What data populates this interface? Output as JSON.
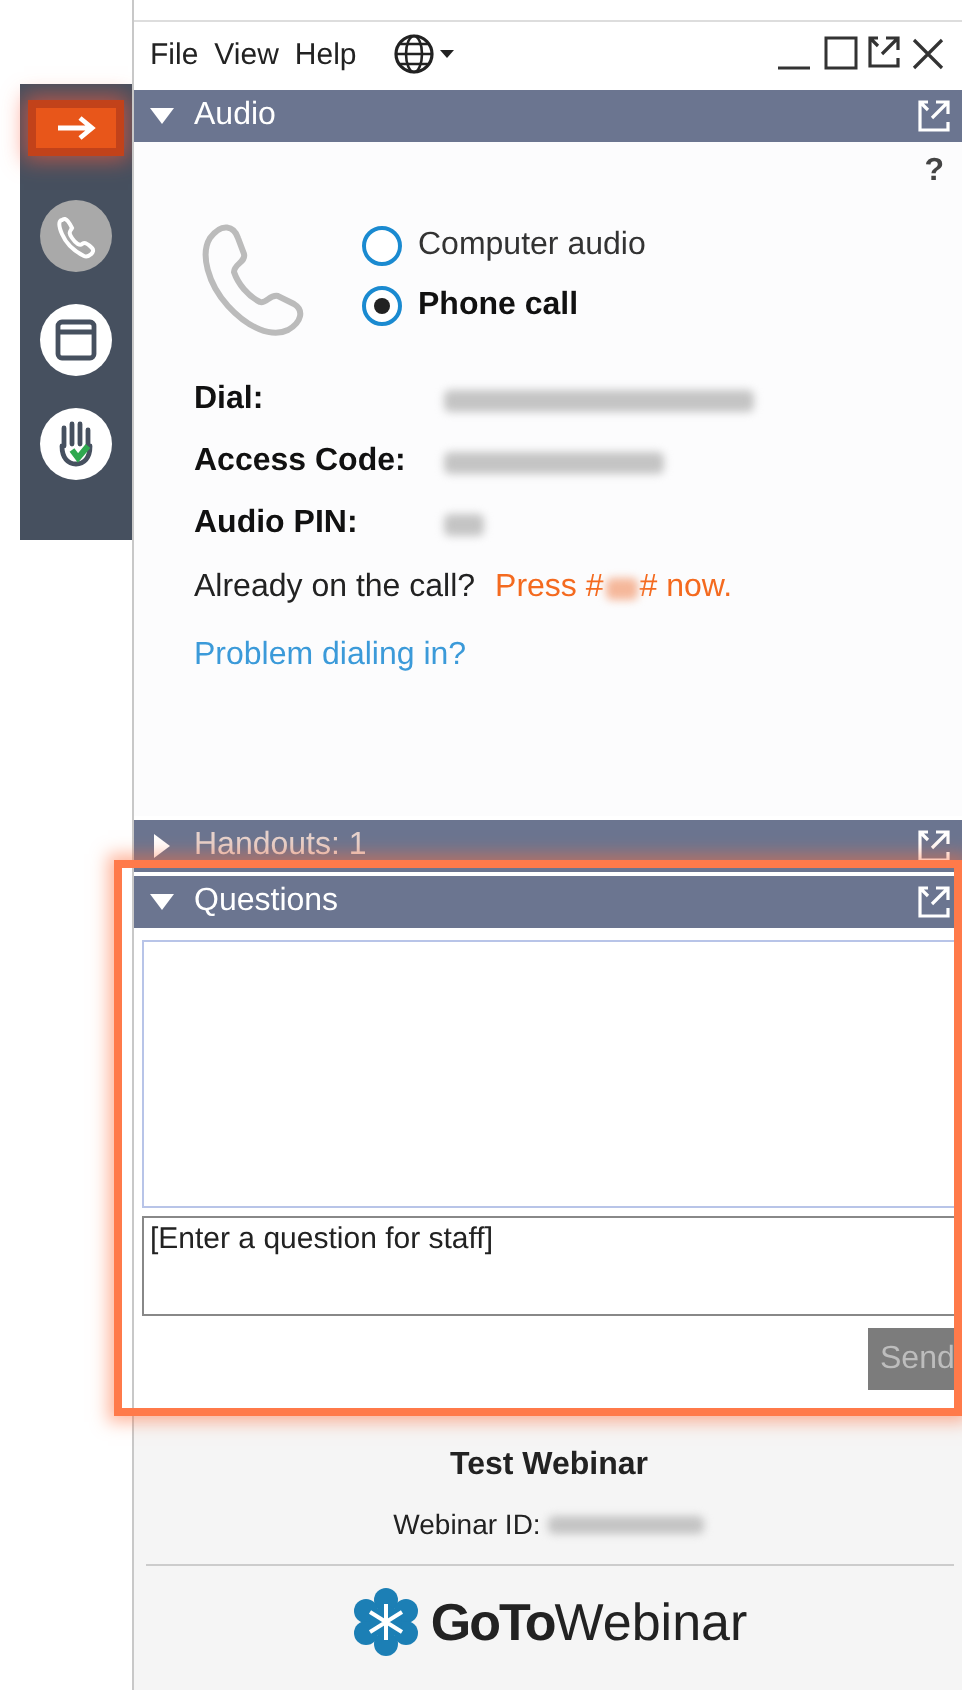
{
  "menu": [
    "File",
    "View",
    "Help"
  ],
  "sidebar": {
    "items": [
      {
        "kind": "arrow",
        "selected": true
      },
      {
        "kind": "phone",
        "selected": false
      },
      {
        "kind": "window",
        "selected": false
      },
      {
        "kind": "hand",
        "selected": false
      }
    ]
  },
  "audio": {
    "title": "Audio",
    "expanded": true,
    "help": "?",
    "options": [
      {
        "label": "Computer audio",
        "selected": false
      },
      {
        "label": "Phone call",
        "selected": true
      }
    ],
    "fields": [
      {
        "label": "Dial:",
        "redacted": true
      },
      {
        "label": "Access Code:",
        "redacted": true
      },
      {
        "label": "Audio PIN:",
        "redacted": true
      }
    ],
    "already": "Already on the call?",
    "press_before": "Press #",
    "press_after": "# now.",
    "problem_link": "Problem dialing in?"
  },
  "handouts": {
    "title": "Handouts: 1",
    "expanded": false
  },
  "questions": {
    "title": "Questions",
    "expanded": true,
    "placeholder": "[Enter a question for staff]",
    "send": "Send",
    "send_disabled": true
  },
  "footer": {
    "title": "Test Webinar",
    "id_label": "Webinar ID:",
    "logo_bold": "GoTo",
    "logo_light": "Webinar"
  }
}
